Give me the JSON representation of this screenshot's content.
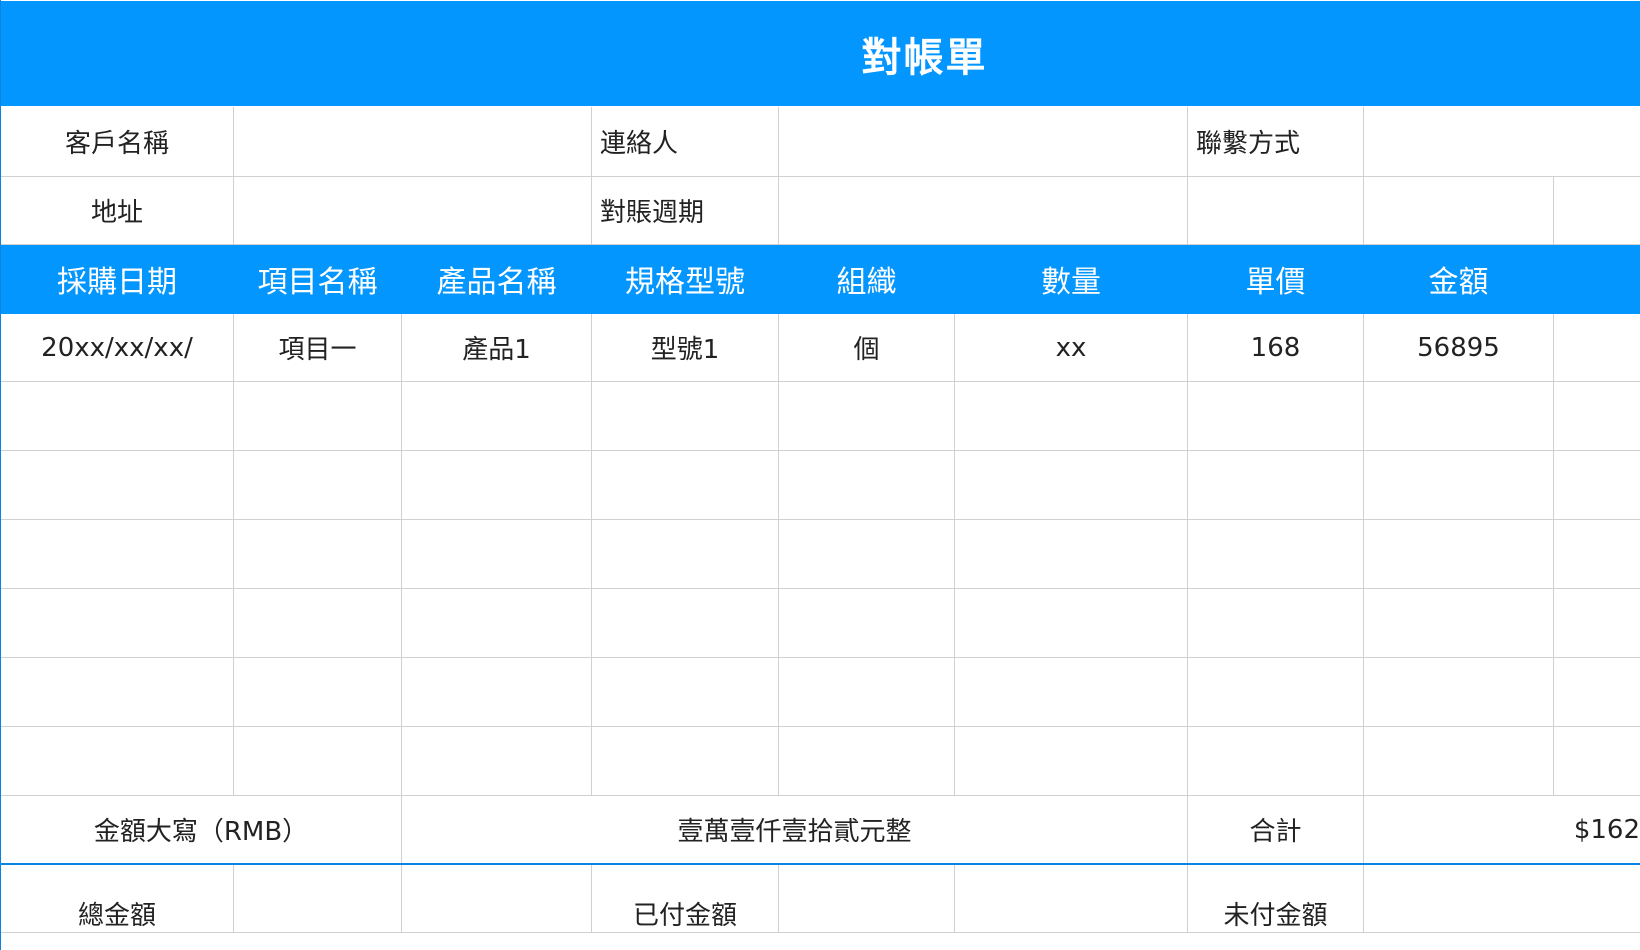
{
  "title": "對帳單",
  "info": {
    "customer_label": "客戶名稱",
    "customer_value": "",
    "contact_label": "連絡人",
    "contact_value": "",
    "method_label": "聯繫方式",
    "method_value": "",
    "address_label": "地址",
    "address_value": "",
    "period_label": "對賬週期",
    "period_value": ""
  },
  "table": {
    "headers": [
      "採購日期",
      "項目名稱",
      "產品名稱",
      "規格型號",
      "組織",
      "數量",
      "單價",
      "金額"
    ],
    "rows": [
      [
        "20xx/xx/xx/",
        "項目一",
        "產品1",
        "型號1",
        "個",
        "xx",
        "168",
        "56895"
      ],
      [
        "",
        "",
        "",
        "",
        "",
        "",
        "",
        ""
      ],
      [
        "",
        "",
        "",
        "",
        "",
        "",
        "",
        ""
      ],
      [
        "",
        "",
        "",
        "",
        "",
        "",
        "",
        ""
      ],
      [
        "",
        "",
        "",
        "",
        "",
        "",
        "",
        ""
      ],
      [
        "",
        "",
        "",
        "",
        "",
        "",
        "",
        ""
      ],
      [
        "",
        "",
        "",
        "",
        "",
        "",
        "",
        ""
      ]
    ]
  },
  "summary": {
    "amount_words_label": "金額大寫（RMB）",
    "amount_words_value": "壹萬壹仟壹拾貳元整",
    "total_label": "合計",
    "total_value": "$162"
  },
  "footer": {
    "grand_total_label": "總金額",
    "paid_label": "已付金額",
    "unpaid_label": "未付金額"
  }
}
